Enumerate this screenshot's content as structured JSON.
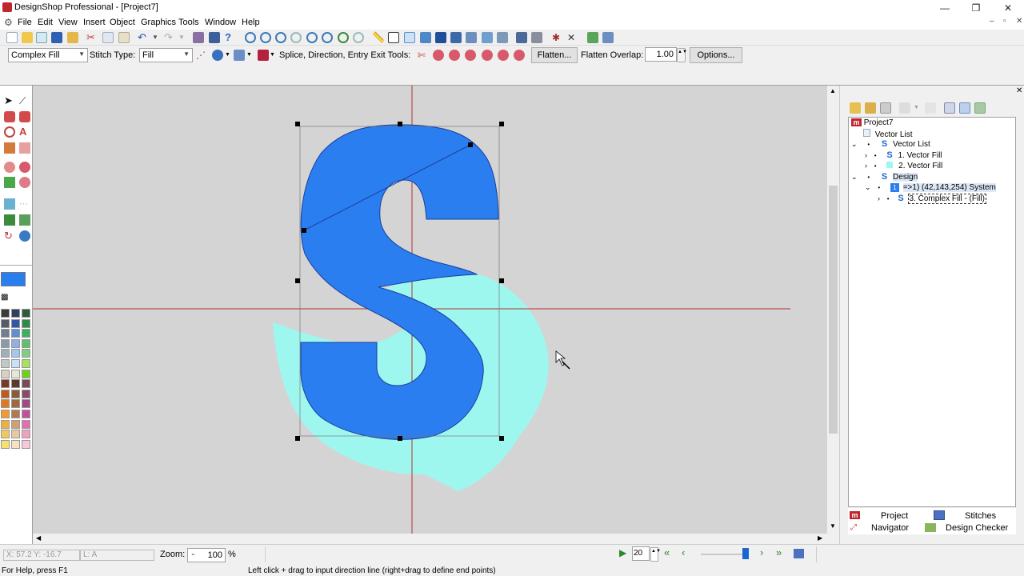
{
  "window": {
    "title": "DesignShop Professional - [Project7]",
    "controls": {
      "minimize": "—",
      "restore": "❐",
      "close": "✕"
    }
  },
  "menu": {
    "items": [
      "File",
      "Edit",
      "View",
      "Insert",
      "Object",
      "Graphics",
      "Tools",
      "Window",
      "Help"
    ],
    "mdi_controls": {
      "minimize": "–",
      "restore": "▫",
      "close": "✕"
    }
  },
  "toolbar2": {
    "object_type": "Complex Fill",
    "stitch_type_label": "Stitch Type:",
    "stitch_type_value": "Fill",
    "tools_label": "Splice, Direction, Entry Exit Tools:",
    "flatten_button": "Flatten...",
    "flatten_overlap_label": "Flatten Overlap:",
    "flatten_overlap_value": "1.00",
    "options_button": "Options..."
  },
  "colors": {
    "letter_fill": "#2a7ef0",
    "backdrop_fill": "#9ef7ee",
    "guide_line": "#b03030",
    "selected_swatch": "#2a7ef0"
  },
  "tree": {
    "nodes": [
      {
        "label": "Project7",
        "icon": "project-m-icon"
      },
      {
        "label": "Vector List",
        "icon": "page-icon"
      },
      {
        "label": "Vector List",
        "icon": "s-vector-icon"
      },
      {
        "label": "1. Vector Fill",
        "icon": "s-vector-icon"
      },
      {
        "label": "2. Vector Fill",
        "icon": "shape-icon"
      },
      {
        "label": "Design",
        "icon": "s-design-icon"
      },
      {
        "label": "=>1) (42,143,254) System",
        "icon": "color-number-icon"
      },
      {
        "label": "3. Complex Fill - (Fill)",
        "icon": "complex-fill-icon"
      }
    ]
  },
  "panel_tabs": {
    "project": "Project",
    "stitches": "Stitches",
    "navigator": "Navigator",
    "design_checker": "Design Checker"
  },
  "status": {
    "coords": "X: 57.2  Y: -16.7",
    "length": "L: A",
    "zoom_label": "Zoom:",
    "zoom_value": "100",
    "zoom_unit": "%",
    "stitch_step": "20",
    "help_left": "For Help, press F1",
    "help_hint": "Left click + drag to input direction line (right+drag to define end points)"
  }
}
